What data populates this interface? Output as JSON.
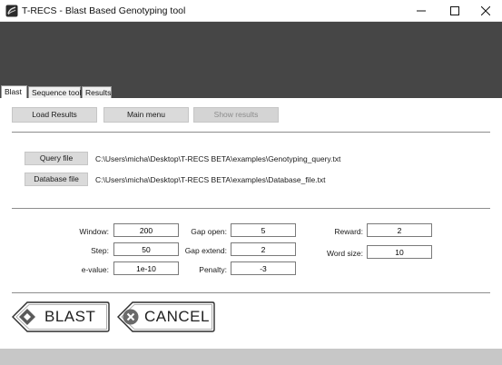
{
  "window": {
    "title": "T-RECS - Blast Based Genotyping tool",
    "controls": [
      "minimize-icon",
      "maximize-icon",
      "close-icon"
    ]
  },
  "tabs": [
    {
      "label": "Blast",
      "active": true
    },
    {
      "label": "Sequence tool",
      "active": false
    },
    {
      "label": "Results",
      "active": false
    }
  ],
  "toolbar": {
    "load_results": "Load Results",
    "main_menu": "Main menu",
    "show_results": "Show results",
    "show_results_enabled": false
  },
  "files": {
    "query_button": "Query file",
    "query_path": "C:\\Users\\micha\\Desktop\\T-RECS BETA\\examples\\Genotyping_query.txt",
    "database_button": "Database file",
    "database_path": "C:\\Users\\micha\\Desktop\\T-RECS BETA\\examples\\Database_file.txt"
  },
  "params": {
    "window_label": "Window:",
    "window_value": "200",
    "step_label": "Step:",
    "step_value": "50",
    "evalue_label": "e-value:",
    "evalue_value": "1e-10",
    "gap_open_label": "Gap open:",
    "gap_open_value": "5",
    "gap_extend_label": "Gap extend:",
    "gap_extend_value": "2",
    "penalty_label": "Penalty:",
    "penalty_value": "-3",
    "reward_label": "Reward:",
    "reward_value": "2",
    "word_size_label": "Word size:",
    "word_size_value": "10"
  },
  "actions": {
    "blast_label": "BLAST",
    "cancel_label": "CANCEL"
  },
  "colors": {
    "header_band": "#464646",
    "button_gray": "#dadada",
    "footer_band": "#c7c7c7"
  }
}
